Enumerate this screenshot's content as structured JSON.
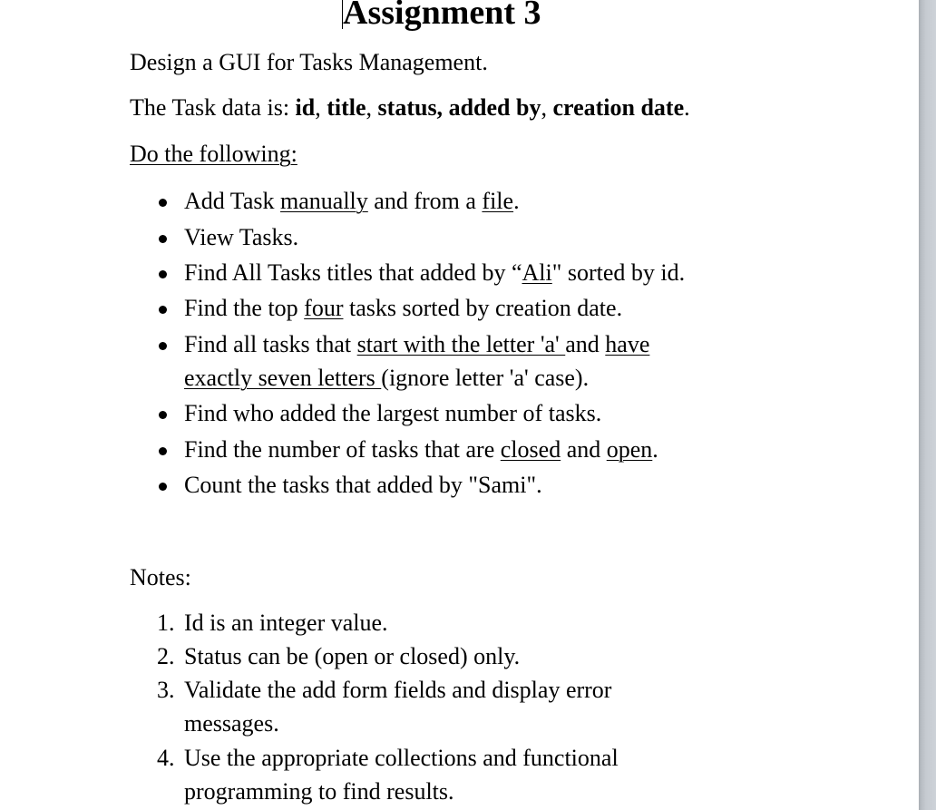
{
  "document": {
    "title": "Assignment 3",
    "intro": "Design a GUI for Tasks Management.",
    "task_data": {
      "prefix": "The Task data is: ",
      "fields": [
        "id",
        "title",
        "status,",
        "added by",
        "creation date"
      ],
      "field_seps": [
        ", ",
        ", ",
        " ",
        ", ",
        "."
      ]
    },
    "do_following": "Do the following:",
    "bullets": [
      {
        "parts": [
          {
            "t": "Add Task "
          },
          {
            "t": "manually",
            "u": true
          },
          {
            "t": " and from a "
          },
          {
            "t": "file",
            "u": true
          },
          {
            "t": "."
          }
        ]
      },
      {
        "parts": [
          {
            "t": "View Tasks."
          }
        ]
      },
      {
        "parts": [
          {
            "t": "Find All Tasks titles that added by “"
          },
          {
            "t": "Ali",
            "u": true
          },
          {
            "t": "\" sorted by id."
          }
        ]
      },
      {
        "parts": [
          {
            "t": "Find the top "
          },
          {
            "t": "four",
            "u": true
          },
          {
            "t": " tasks sorted by creation date."
          }
        ]
      },
      {
        "parts": [
          {
            "t": "Find all tasks that "
          },
          {
            "t": "start with the letter 'a' ",
            "u": true
          },
          {
            "t": "and "
          },
          {
            "t": "have",
            "u": true
          }
        ],
        "cont": [
          {
            "t": "exactly seven letters ",
            "u": true
          },
          {
            "t": "(ignore letter 'a' case)."
          }
        ]
      },
      {
        "parts": [
          {
            "t": "Find who added the largest number of tasks."
          }
        ]
      },
      {
        "parts": [
          {
            "t": "Find the number of tasks that are "
          },
          {
            "t": "closed",
            "u": true
          },
          {
            "t": " and "
          },
          {
            "t": "open",
            "u": true
          },
          {
            "t": "."
          }
        ]
      },
      {
        "parts": [
          {
            "t": "Count the tasks that added by \"Sami\"."
          }
        ]
      }
    ],
    "notes_heading": "Notes:",
    "notes": [
      {
        "num": "1.",
        "lines": [
          "Id is an integer value."
        ]
      },
      {
        "num": "2.",
        "lines": [
          "Status can be (open or closed) only."
        ]
      },
      {
        "num": "3.",
        "lines": [
          "Validate the add form fields and display error",
          "messages."
        ]
      },
      {
        "num": "4.",
        "lines": [
          "Use the appropriate collections and functional",
          "programming to find results."
        ]
      }
    ]
  }
}
